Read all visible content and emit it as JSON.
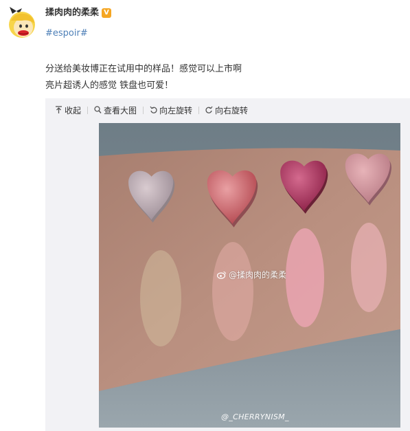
{
  "user": {
    "name": "揉肉肉的柔柔",
    "verified_badge": "V",
    "avatar_icon": "cartoon-blonde-girl-avatar"
  },
  "post": {
    "hashtag": "#espoir#",
    "lines": [
      "分送给美妆博正在试用中的样品！感觉可以上市啊",
      "亮片超诱人的感觉 铁盘也可爱！"
    ]
  },
  "toolbar": {
    "collapse": "收起",
    "view_large": "查看大图",
    "rotate_left": "向左旋转",
    "rotate_right": "向右旋转"
  },
  "image": {
    "watermark": "@揉肉肉的柔柔",
    "credit": "@_CHERRYNISM_"
  },
  "colors": {
    "link": "#4d7fb7",
    "verified": "#f5a623",
    "media_background": "#f2f2f5"
  }
}
